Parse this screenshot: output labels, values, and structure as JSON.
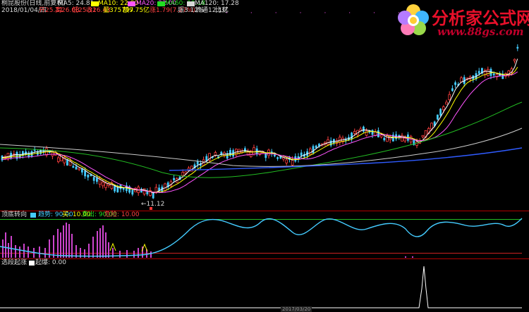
{
  "colors": {
    "white": "#d8d8d8",
    "yellow": "#ffff00",
    "magenta": "#ff55ff",
    "green": "#22dd22",
    "red": "#ff4040",
    "cyan": "#44ccff",
    "orange": "#ffaa00",
    "logo_red": "#e8102a",
    "logo_text2": "#c2002b"
  },
  "header": {
    "line1": {
      "name": "桐昆股份(日线,前复权)",
      "ma5": "MA5: 24.81",
      "ma10": "MA10: 22.80",
      "ma20": "MA20: 22.00",
      "ma60": "MA60: 19.18",
      "ma120": "MA120: 17.28"
    },
    "line2": {
      "date": "2018/01/04/四",
      "open": "开25.31",
      "high": "高26.08",
      "low": "低25.31",
      "close": "收26.43",
      "vol": "量375797",
      "amount": "额9.75亿",
      "change": "涨1.79(7.27%)",
      "amp": "振3.12%",
      "float": "流通12.1亿",
      "extra": "比对"
    }
  },
  "annotations": {
    "low_price": "←11.12"
  },
  "panel2": {
    "title": "顶底转向",
    "v1": "趋势: 90.00",
    "v2": "买: 10.00",
    "v3": "卖出: 90.00",
    "v4": "危险: 10.00"
  },
  "panel3": {
    "title": "选段起涨",
    "v1": "起爆: 0.00"
  },
  "bottom_date": "2017/03/20",
  "logo": {
    "title": "分析家公式网",
    "url": "www.88gs.com",
    "icon": "flower-icon"
  }
}
